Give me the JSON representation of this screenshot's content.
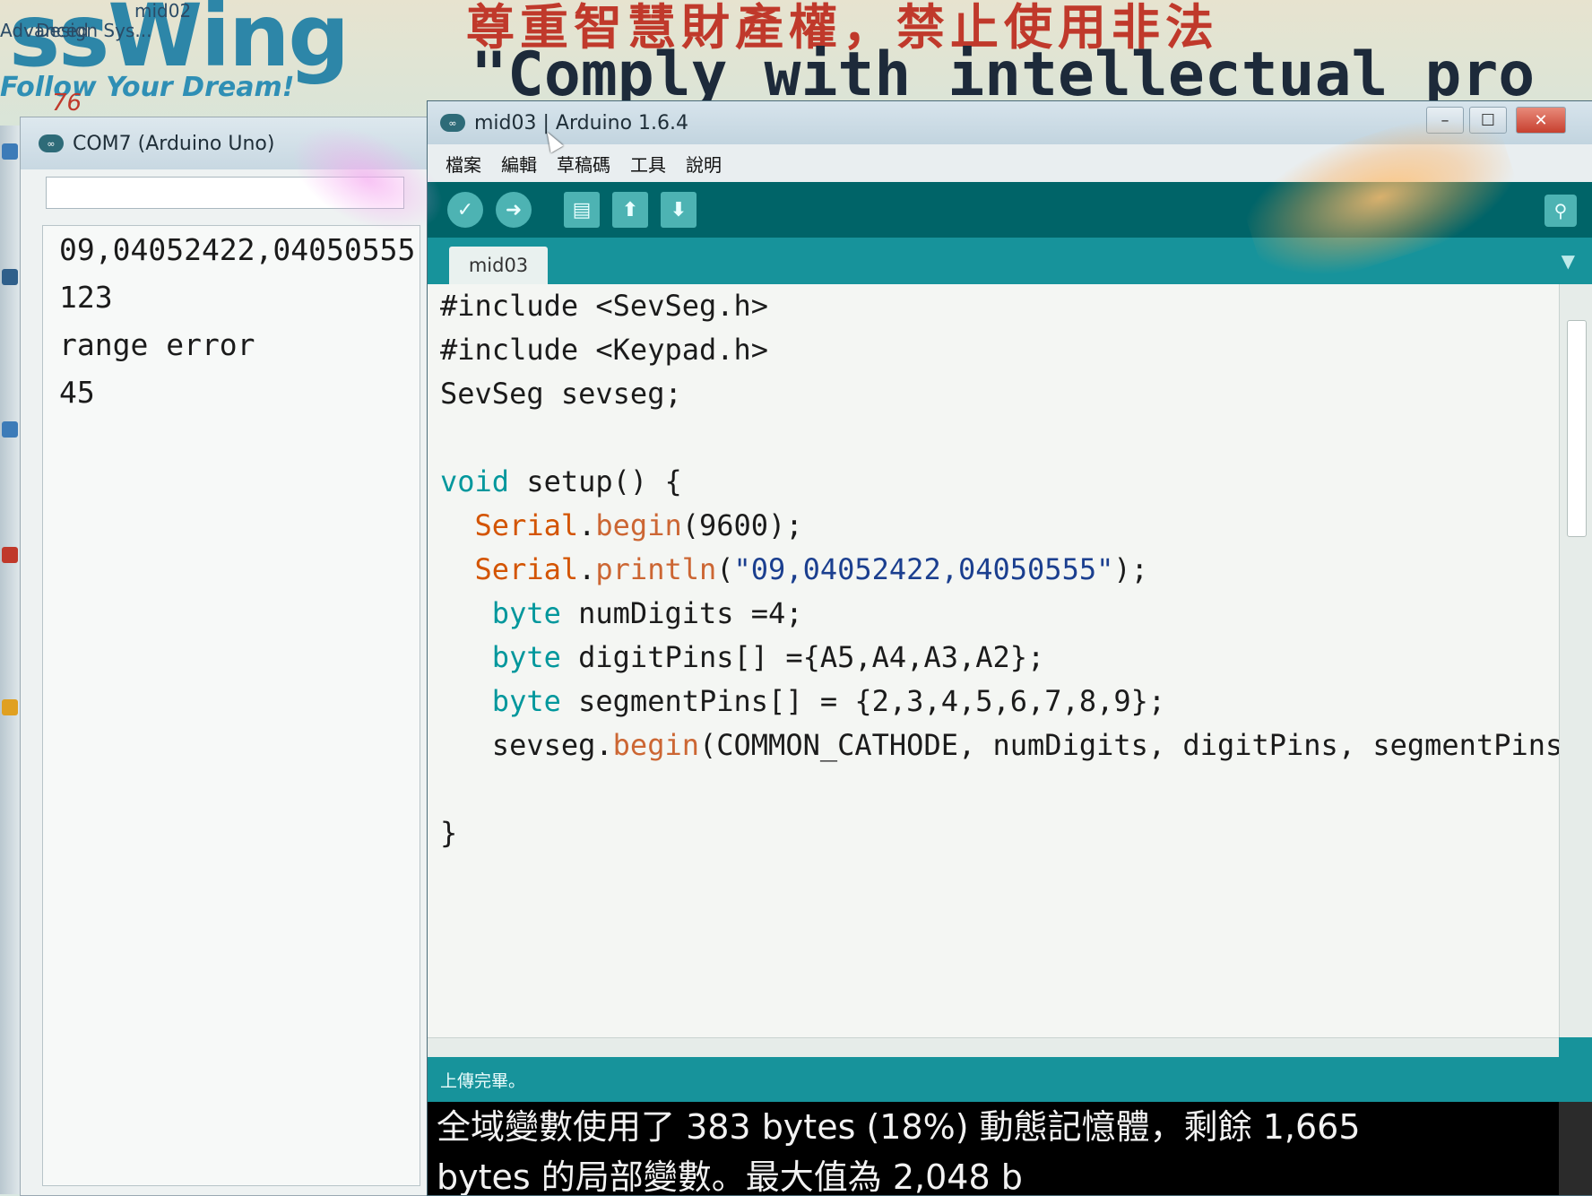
{
  "wallpaper": {
    "logo": "ssWing",
    "caption_left": "Advanced",
    "caption_left2": "Design Sys...",
    "caption_right": "mid02",
    "slogan": "Follow Your Dream!",
    "badge": "76",
    "banner_cn": "尊重智慧財產權，禁止使用非法",
    "banner_en": "\"Comply with intellectual pro"
  },
  "serial_monitor": {
    "title": "COM7 (Arduino Uno)",
    "input_value": "",
    "output_lines": [
      "09,04052422,04050555",
      "123",
      "range error",
      "45"
    ]
  },
  "ide": {
    "title": "mid03 | Arduino 1.6.4",
    "menu": [
      "檔案",
      "編輯",
      "草稿碼",
      "工具",
      "說明"
    ],
    "toolbar": {
      "verify_icon": "check-icon",
      "upload_icon": "arrow-right-icon",
      "new_icon": "document-icon",
      "open_icon": "arrow-up-icon",
      "save_icon": "arrow-down-icon",
      "serial_monitor_icon": "magnifier-icon"
    },
    "tab": "mid03",
    "code": [
      {
        "parts": [
          {
            "t": "#include <SevSeg.h>",
            "c": ""
          }
        ]
      },
      {
        "parts": [
          {
            "t": "#include <Keypad.h>",
            "c": ""
          }
        ]
      },
      {
        "parts": [
          {
            "t": "SevSeg sevseg;",
            "c": ""
          }
        ]
      },
      {
        "parts": [
          {
            "t": "",
            "c": ""
          }
        ]
      },
      {
        "parts": [
          {
            "t": "void",
            "c": "kw-type"
          },
          {
            "t": " setup() {",
            "c": ""
          }
        ]
      },
      {
        "parts": [
          {
            "t": "  ",
            "c": ""
          },
          {
            "t": "Serial",
            "c": "kw-obj"
          },
          {
            "t": ".",
            "c": ""
          },
          {
            "t": "begin",
            "c": "kw-fn"
          },
          {
            "t": "(9600);",
            "c": ""
          }
        ]
      },
      {
        "parts": [
          {
            "t": "  ",
            "c": ""
          },
          {
            "t": "Serial",
            "c": "kw-obj"
          },
          {
            "t": ".",
            "c": ""
          },
          {
            "t": "println",
            "c": "kw-fn"
          },
          {
            "t": "(",
            "c": ""
          },
          {
            "t": "\"09,04052422,04050555\"",
            "c": "str"
          },
          {
            "t": ");",
            "c": ""
          }
        ]
      },
      {
        "parts": [
          {
            "t": "   ",
            "c": ""
          },
          {
            "t": "byte",
            "c": "kw-type"
          },
          {
            "t": " numDigits =4;",
            "c": ""
          }
        ]
      },
      {
        "parts": [
          {
            "t": "   ",
            "c": ""
          },
          {
            "t": "byte",
            "c": "kw-type"
          },
          {
            "t": " digitPins[] ={A5,A4,A3,A2};",
            "c": ""
          }
        ]
      },
      {
        "parts": [
          {
            "t": "   ",
            "c": ""
          },
          {
            "t": "byte",
            "c": "kw-type"
          },
          {
            "t": " segmentPins[] = {2,3,4,5,6,7,8,9};",
            "c": ""
          }
        ]
      },
      {
        "parts": [
          {
            "t": "   sevseg.",
            "c": ""
          },
          {
            "t": "begin",
            "c": "kw-fn"
          },
          {
            "t": "(COMMON_CATHODE, numDigits, digitPins, segmentPins);",
            "c": ""
          }
        ]
      },
      {
        "parts": [
          {
            "t": "",
            "c": ""
          }
        ]
      },
      {
        "parts": [
          {
            "t": "}",
            "c": ""
          }
        ]
      }
    ],
    "status": "上傳完畢。",
    "console_lines": [
      "全域變數使用了 383 bytes (18%) 動態記憶體，剩餘 1,665",
      "bytes 的局部變數。最大值為 2,048 b"
    ]
  }
}
